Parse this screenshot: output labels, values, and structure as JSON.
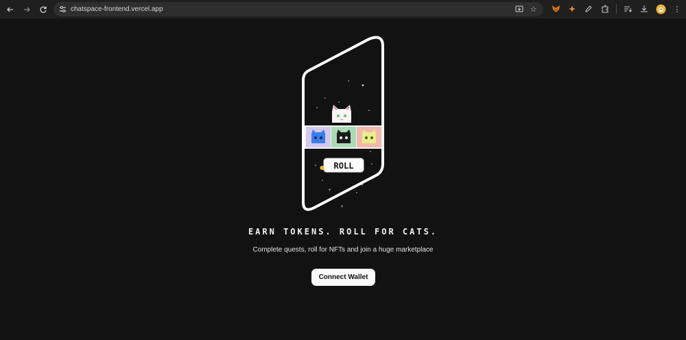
{
  "browser": {
    "url": "chatspace-frontend.vercel.app",
    "icons": {
      "back": "arrow-left-icon",
      "forward": "arrow-right-icon",
      "reload": "reload-icon",
      "site_info": "tune-icon",
      "install": "install-app-icon",
      "bookmark": "star-icon",
      "extensions": [
        "metamask-icon",
        "phantom-icon",
        "pen-icon",
        "puzzle-icon",
        "reading-list-icon",
        "download-icon",
        "profile-avatar-icon",
        "kebab-menu-icon"
      ]
    }
  },
  "hero": {
    "roll_label": "ROLL",
    "headline": "EARN TOKENS. ROLL FOR CATS.",
    "subtitle": "Complete quests, roll for NFTs and join a huge marketplace",
    "cta_label": "Connect Wallet"
  },
  "colors": {
    "background": "#121212",
    "cat_tile_1": "#d4c8ee",
    "cat_tile_2": "#a9dcb4",
    "cat_tile_3": "#f2b8ad",
    "cat_blue": "#3a7ee8",
    "cat_yellow": "#e8ee88"
  }
}
